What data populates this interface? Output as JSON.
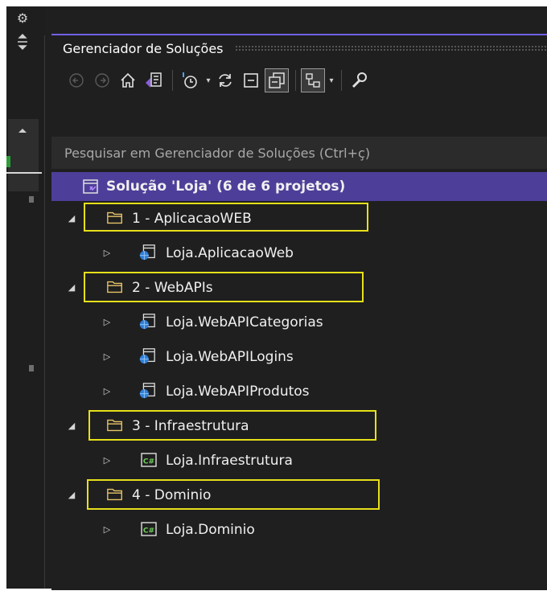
{
  "panel": {
    "title": "Gerenciador de Soluções",
    "search_placeholder": "Pesquisar em Gerenciador de Soluções (Ctrl+ç)"
  },
  "toolbar": {
    "icons": [
      "back-icon",
      "forward-icon",
      "home-icon",
      "switch-views-icon",
      "pending-changes-filter-icon",
      "sync-icon",
      "collapse-all-icon",
      "show-all-files-icon",
      "properties-icon",
      "settings-icon"
    ]
  },
  "tree": {
    "solution": "Solução 'Loja' (6 de 6 projetos)",
    "folders": [
      {
        "label": "1 - AplicacaoWEB",
        "projects": [
          {
            "label": "Loja.AplicacaoWeb",
            "type": "web"
          }
        ]
      },
      {
        "label": "2 - WebAPIs",
        "projects": [
          {
            "label": "Loja.WebAPICategorias",
            "type": "web"
          },
          {
            "label": "Loja.WebAPILogins",
            "type": "web"
          },
          {
            "label": "Loja.WebAPIProdutos",
            "type": "web"
          }
        ]
      },
      {
        "label": "3 - Infraestrutura",
        "projects": [
          {
            "label": "Loja.Infraestrutura",
            "type": "csharp"
          }
        ]
      },
      {
        "label": "4 - Dominio",
        "projects": [
          {
            "label": "Loja.Dominio",
            "type": "csharp"
          }
        ]
      }
    ]
  },
  "colors": {
    "highlight_box": "#e6e01a",
    "selected_row": "#4d3f99",
    "accent": "#7160e8"
  }
}
